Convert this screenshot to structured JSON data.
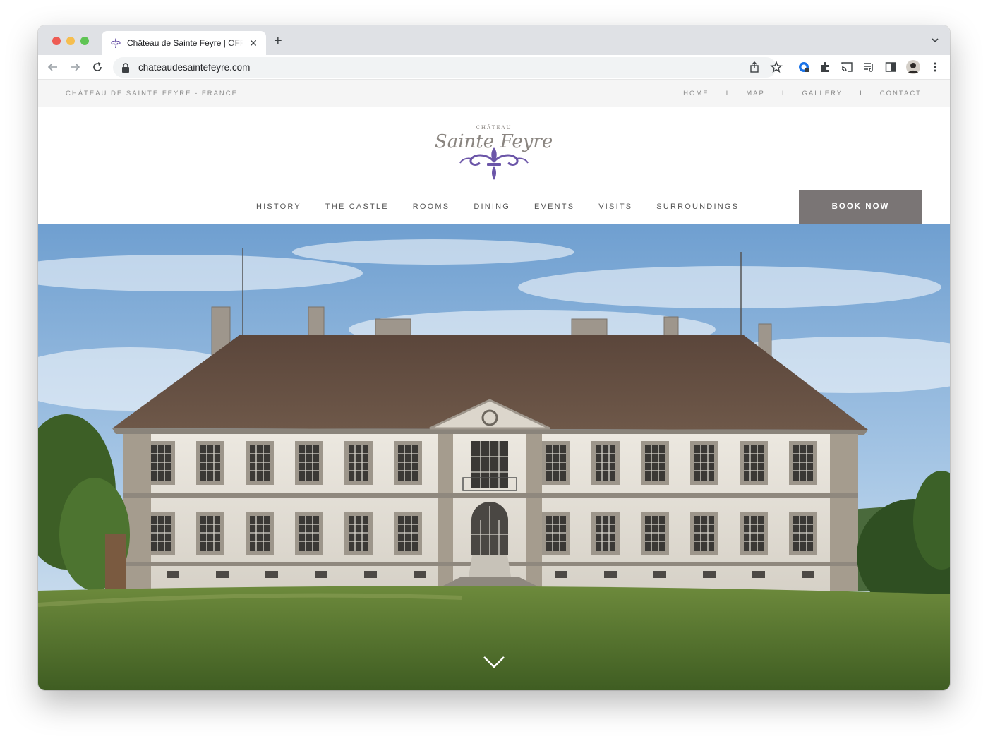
{
  "browser": {
    "tab_title": "Château de Sainte Feyre | OFFICIAL",
    "tab_close": "✕",
    "new_tab": "+",
    "url": "chateaudesaintefeyre.com"
  },
  "site": {
    "brand": "CHÂTEAU DE SAINTE FEYRE - FRANCE",
    "util_nav": [
      "HOME",
      "MAP",
      "GALLERY",
      "CONTACT"
    ],
    "util_separator": "I",
    "logo": {
      "top": "CHÂTEAU",
      "left": "Sainte",
      "right": "Feyre"
    },
    "main_nav": [
      "HISTORY",
      "THE CASTLE",
      "ROOMS",
      "DINING",
      "EVENTS",
      "VISITS",
      "SURROUNDINGS"
    ],
    "book_label": "BOOK NOW"
  },
  "hero": {
    "scroll_icon": "chevron-down-icon"
  },
  "colors": {
    "book_button": "#7a7575",
    "logo_purple": "#6b55a8",
    "topbar": "#f5f5f5"
  }
}
